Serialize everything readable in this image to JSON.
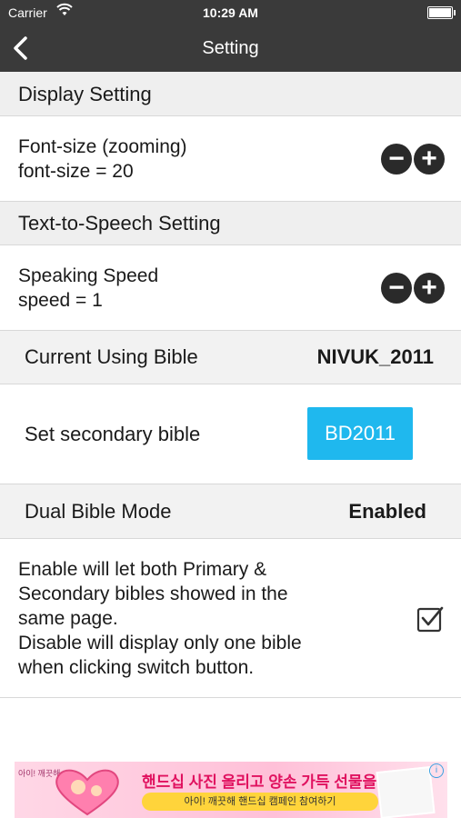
{
  "status_bar": {
    "carrier": "Carrier",
    "time": "10:29 AM"
  },
  "nav": {
    "title": "Setting"
  },
  "display_section": {
    "header": "Display Setting",
    "font_label": "Font-size (zooming)",
    "font_value": "font-size = 20"
  },
  "tts_section": {
    "header": "Text-to-Speech Setting",
    "speed_label": "Speaking Speed",
    "speed_value": "speed = 1"
  },
  "current_bible": {
    "label": "Current Using Bible",
    "value": "NIVUK_2011"
  },
  "secondary_bible": {
    "label": "Set secondary bible",
    "button": "BD2011",
    "button_color": "#1fb8ee"
  },
  "dual_mode": {
    "label": "Dual Bible Mode",
    "value": "Enabled",
    "description": [
      "Enable will let both Primary &",
      "Secondary bibles showed in the",
      "same page.",
      "Disable will display only one bible",
      "when clicking switch button."
    ],
    "checked": true
  },
  "ad": {
    "small_text": "아이! 깨끗해",
    "headline": "핸드십 사진 올리고 양손 가득 선물을!",
    "pill_text": "아이! 깨끗해 핸드십 캠페인 참여하기",
    "info_icon": "i"
  },
  "colors": {
    "nav_bg": "#3a3a3a",
    "section_bg": "#efefef",
    "accent": "#1fb8ee"
  }
}
